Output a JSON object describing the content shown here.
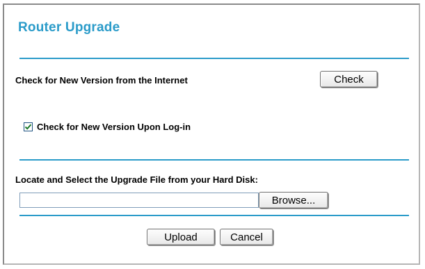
{
  "page": {
    "title": "Router Upgrade"
  },
  "online_check": {
    "label": "Check for New Version from the Internet",
    "button_label": "Check"
  },
  "login_check": {
    "label": "Check for New Version Upon Log-in",
    "checked": true
  },
  "upgrade_file": {
    "label": "Locate and Select the Upgrade File from your Hard Disk:",
    "value": "",
    "browse_label": "Browse..."
  },
  "actions": {
    "upload_label": "Upload",
    "cancel_label": "Cancel"
  },
  "colors": {
    "accent": "#2a9bc9",
    "checkmark": "#1c7a2a"
  }
}
